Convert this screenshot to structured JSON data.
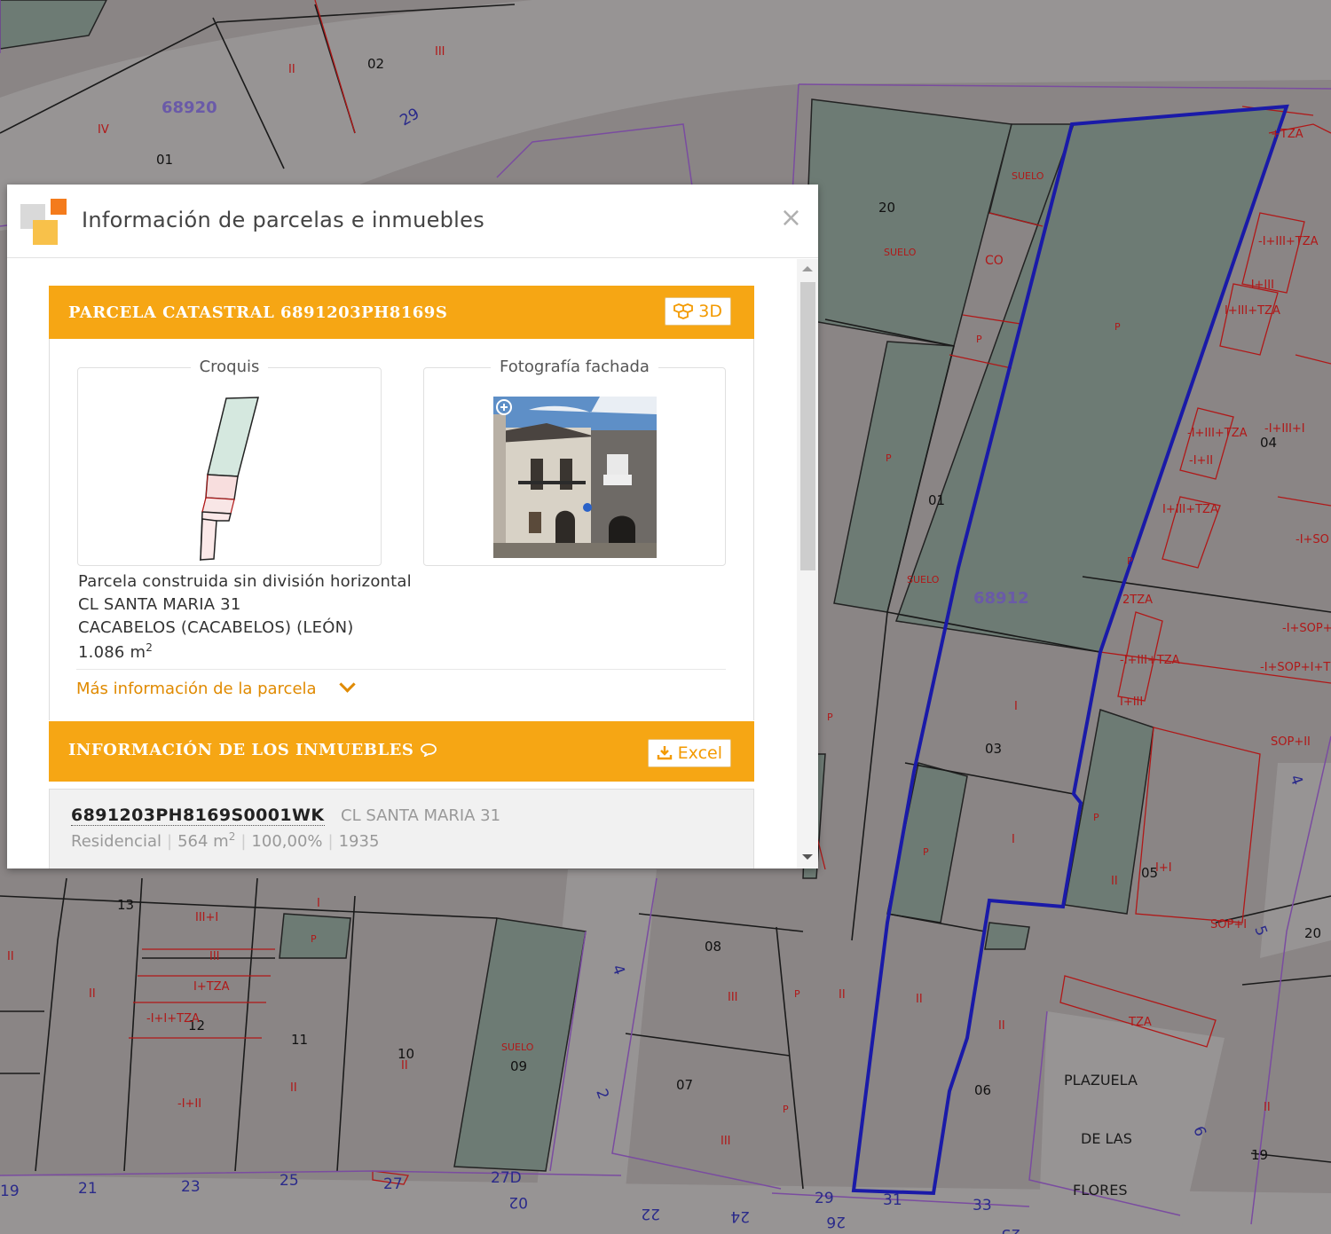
{
  "map": {
    "parcel_numbers": [
      "01",
      "02",
      "03",
      "04",
      "05",
      "06",
      "07",
      "08",
      "09",
      "10",
      "11",
      "12",
      "13",
      "19",
      "20",
      "01",
      "02"
    ],
    "block_ids": [
      "68920",
      "68912"
    ],
    "street_numbers": [
      "29",
      "4",
      "2",
      "5",
      "6",
      "4",
      "19",
      "21",
      "23",
      "25",
      "27",
      "27D",
      "29",
      "31",
      "33",
      "22",
      "24",
      "26",
      "02",
      "25"
    ],
    "labels": [
      "SUELO",
      "CO",
      "P",
      "I",
      "II",
      "III",
      "IV",
      "III+I",
      "I+TZA",
      "-I+I+TZA",
      "-I+II",
      "II+I",
      "-I+III+I",
      "I+III+TZA",
      "-I+III",
      "I+III+TZA",
      "2TZA",
      "SOP+I",
      "TZA",
      "I+III"
    ],
    "place_name": [
      "PLAZUELA",
      "DE LAS",
      "FLORES"
    ]
  },
  "popup": {
    "title": "Información de parcelas e inmuebles",
    "close": "×",
    "parcel": {
      "header": "PARCELA CATASTRAL 6891203PH8169S",
      "btn_3d": "3D",
      "croquis_label": "Croquis",
      "photo_label": "Fotografía fachada",
      "type": "Parcela construida sin división horizontal",
      "address": "CL SANTA MARIA 31",
      "municipality": "CACABELOS (CACABELOS) (LEÓN)",
      "area": "1.086 m",
      "area_sup": "2",
      "more_info": "Más información de la parcela"
    },
    "properties": {
      "header": "INFORMACIÓN DE LOS INMUEBLES",
      "btn_excel": "Excel",
      "items": [
        {
          "ref": "6891203PH8169S0001WK",
          "address": "CL SANTA MARIA 31",
          "use": "Residencial",
          "surface": "564 m",
          "surface_sup": "2",
          "share": "100,00%",
          "year": "1935"
        }
      ]
    }
  },
  "colors": {
    "accent": "#f6a614",
    "highlight": "#1a1aa8",
    "parcel_fill": "#8a8585",
    "green_parcel": "#6d7b74",
    "red_lines": "#b01818",
    "purple_lines": "#7a4ca0"
  }
}
